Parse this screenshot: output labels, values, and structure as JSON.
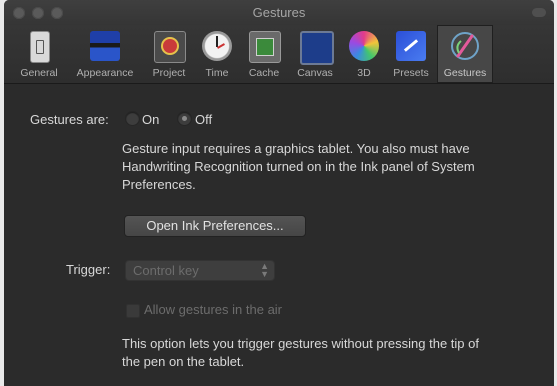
{
  "window": {
    "title": "Gestures"
  },
  "toolbar": {
    "items": [
      {
        "label": "General",
        "icon": "switch-icon"
      },
      {
        "label": "Appearance",
        "icon": "appearance-icon"
      },
      {
        "label": "Project",
        "icon": "project-icon"
      },
      {
        "label": "Time",
        "icon": "stopwatch-icon"
      },
      {
        "label": "Cache",
        "icon": "cache-icon"
      },
      {
        "label": "Canvas",
        "icon": "canvas-icon"
      },
      {
        "label": "3D",
        "icon": "sphere-icon"
      },
      {
        "label": "Presets",
        "icon": "presets-icon"
      },
      {
        "label": "Gestures",
        "icon": "stylus-icon"
      }
    ],
    "selected": "Gestures"
  },
  "gestures": {
    "label": "Gestures are:",
    "on_label": "On",
    "off_label": "Off",
    "selected": "Off",
    "desc_line1": "Gesture input requires a graphics tablet. You also must have",
    "desc_line2": "Handwriting Recognition turned on in the Ink panel of System",
    "desc_line3": "Preferences.",
    "open_ink_button": "Open Ink Preferences...",
    "trigger_label": "Trigger:",
    "trigger_value": "Control key",
    "allow_air_label": "Allow gestures in the air",
    "option_line1": "This option lets you trigger gestures without pressing the tip of",
    "option_line2": "the pen on the tablet."
  },
  "colors": {
    "window_bg": "#2b2b2b",
    "toolbar_bg": "#333333",
    "selected_tab_bg": "#474747",
    "text": "#d8d8d8",
    "disabled_text": "#6c6c6c"
  }
}
